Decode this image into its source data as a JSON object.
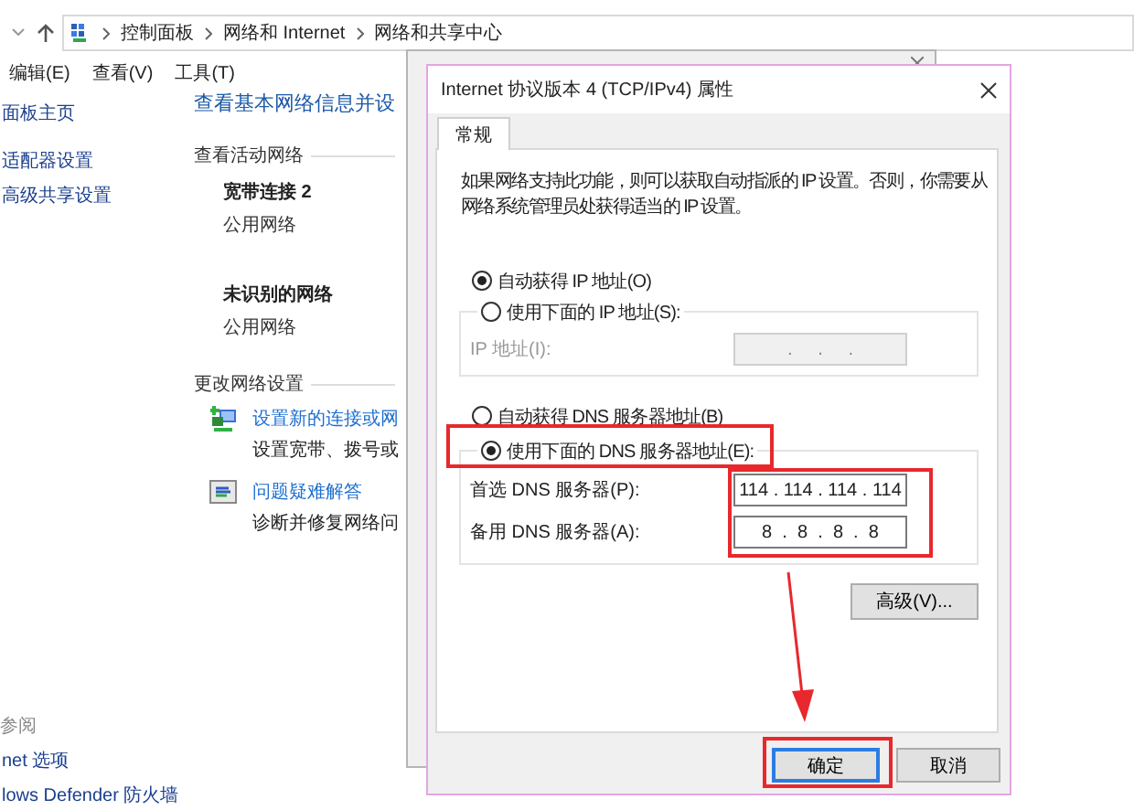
{
  "address_bar": {
    "path": [
      "控制面板",
      "网络和 Internet",
      "网络和共享中心"
    ]
  },
  "menu": [
    "编辑(E)",
    "查看(V)",
    "工具(T)"
  ],
  "sidebar": {
    "links": [
      "面板主页",
      "适配器设置",
      "高级共享设置"
    ],
    "see_also": {
      "heading": "参阅",
      "links": [
        "net 选项",
        "lows Defender 防火墙"
      ]
    }
  },
  "main": {
    "title": "查看基本网络信息并设",
    "active_networks": {
      "heading": "查看活动网络",
      "networks": [
        {
          "name": "宽带连接 2",
          "type": "公用网络"
        },
        {
          "name": "未识别的网络",
          "type": "公用网络"
        }
      ]
    },
    "change_settings": {
      "heading": "更改网络设置",
      "tasks": [
        {
          "kind": "connection",
          "link": "设置新的连接或网",
          "description": "设置宽带、拨号或"
        },
        {
          "kind": "troubleshoot",
          "link": "问题疑难解答",
          "description": "诊断并修复网络问"
        }
      ]
    }
  },
  "dialog": {
    "title": "Internet 协议版本 4 (TCP/IPv4) 属性",
    "tabs": [
      {
        "label": "常规",
        "selected": true
      }
    ],
    "description_lines": [
      "如果网络支持此功能，则可以获取自动指派的 IP 设置。否则，你需要从",
      "网络系统管理员处获得适当的 IP 设置。"
    ],
    "ip_options": [
      {
        "label": "自动获得 IP 地址(O)",
        "selected": true
      },
      {
        "label": "使用下面的 IP 地址(S):",
        "selected": false
      }
    ],
    "ip_fields": [
      {
        "label": "IP 地址(I):",
        "value": ".     .     .",
        "disabled": true
      }
    ],
    "dns_options": [
      {
        "label": "自动获得 DNS 服务器地址(B)",
        "selected": false
      },
      {
        "label": "使用下面的 DNS 服务器地址(E):",
        "selected": true
      }
    ],
    "dns_fields": [
      {
        "label": "首选 DNS 服务器(P):",
        "value": "114 . 114 . 114 . 114",
        "disabled": false
      },
      {
        "label": "备用 DNS 服务器(A):",
        "value": "8  .  8  .  8  .  8",
        "disabled": false
      }
    ],
    "advanced_button": "高级(V)...",
    "buttons": [
      {
        "label": "确定",
        "focused": true
      },
      {
        "label": "取消",
        "focused": false
      }
    ]
  }
}
